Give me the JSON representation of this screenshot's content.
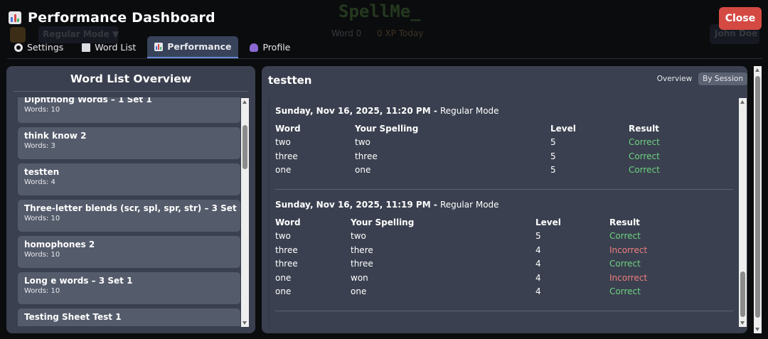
{
  "background_app": {
    "logo": "SpellMe_",
    "mode": "Regular Mode ▼",
    "word_count": "Word 0",
    "xp": "0 XP Today",
    "user": "John Doe"
  },
  "modal": {
    "title": "Performance Dashboard",
    "close_label": "Close",
    "tabs": [
      {
        "label": "Settings",
        "icon": "gear-icon",
        "active": false
      },
      {
        "label": "Word List",
        "icon": "book-icon",
        "active": false
      },
      {
        "label": "Performance",
        "icon": "chart-icon",
        "active": true
      },
      {
        "label": "Profile",
        "icon": "user-icon",
        "active": false
      }
    ]
  },
  "word_list_panel": {
    "title": "Word List Overview",
    "lists": [
      {
        "name": "Diphthong Words – 1 Set 1",
        "count": "Words: 10"
      },
      {
        "name": "think know 2",
        "count": "Words: 3"
      },
      {
        "name": "testten",
        "count": "Words: 4"
      },
      {
        "name": "Three-letter blends (scr, spl, spr, str) – 3 Set 2",
        "count": "Words: 10"
      },
      {
        "name": "homophones 2",
        "count": "Words: 10"
      },
      {
        "name": "Long e words – 3 Set 1",
        "count": "Words: 10"
      },
      {
        "name": "Testing Sheet Test 1",
        "count": ""
      }
    ]
  },
  "detail_panel": {
    "title": "testten",
    "view_options": [
      "Overview",
      "By Session"
    ],
    "active_view": "By Session",
    "columns": [
      "Word",
      "Your Spelling",
      "Level",
      "Result"
    ],
    "sessions": [
      {
        "date": "Sunday, Nov 16, 2025, 11:20 PM",
        "separator": " - ",
        "mode": "Regular Mode",
        "rows": [
          {
            "word": "two",
            "spelling": "two",
            "level": "5",
            "result": "Correct"
          },
          {
            "word": "three",
            "spelling": "three",
            "level": "5",
            "result": "Correct"
          },
          {
            "word": "one",
            "spelling": "one",
            "level": "5",
            "result": "Correct"
          }
        ]
      },
      {
        "date": "Sunday, Nov 16, 2025, 11:19 PM",
        "separator": " - ",
        "mode": "Regular Mode",
        "rows": [
          {
            "word": "two",
            "spelling": "two",
            "level": "5",
            "result": "Correct"
          },
          {
            "word": "three",
            "spelling": "there",
            "level": "4",
            "result": "Incorrect"
          },
          {
            "word": "three",
            "spelling": "three",
            "level": "4",
            "result": "Correct"
          },
          {
            "word": "one",
            "spelling": "won",
            "level": "4",
            "result": "Incorrect"
          },
          {
            "word": "one",
            "spelling": "one",
            "level": "4",
            "result": "Correct"
          }
        ]
      }
    ]
  },
  "colors": {
    "correct": "#6ed280",
    "incorrect": "#f07e7e",
    "close_button": "#d44a43",
    "panel": "#3a404f",
    "card": "#545b6b"
  }
}
